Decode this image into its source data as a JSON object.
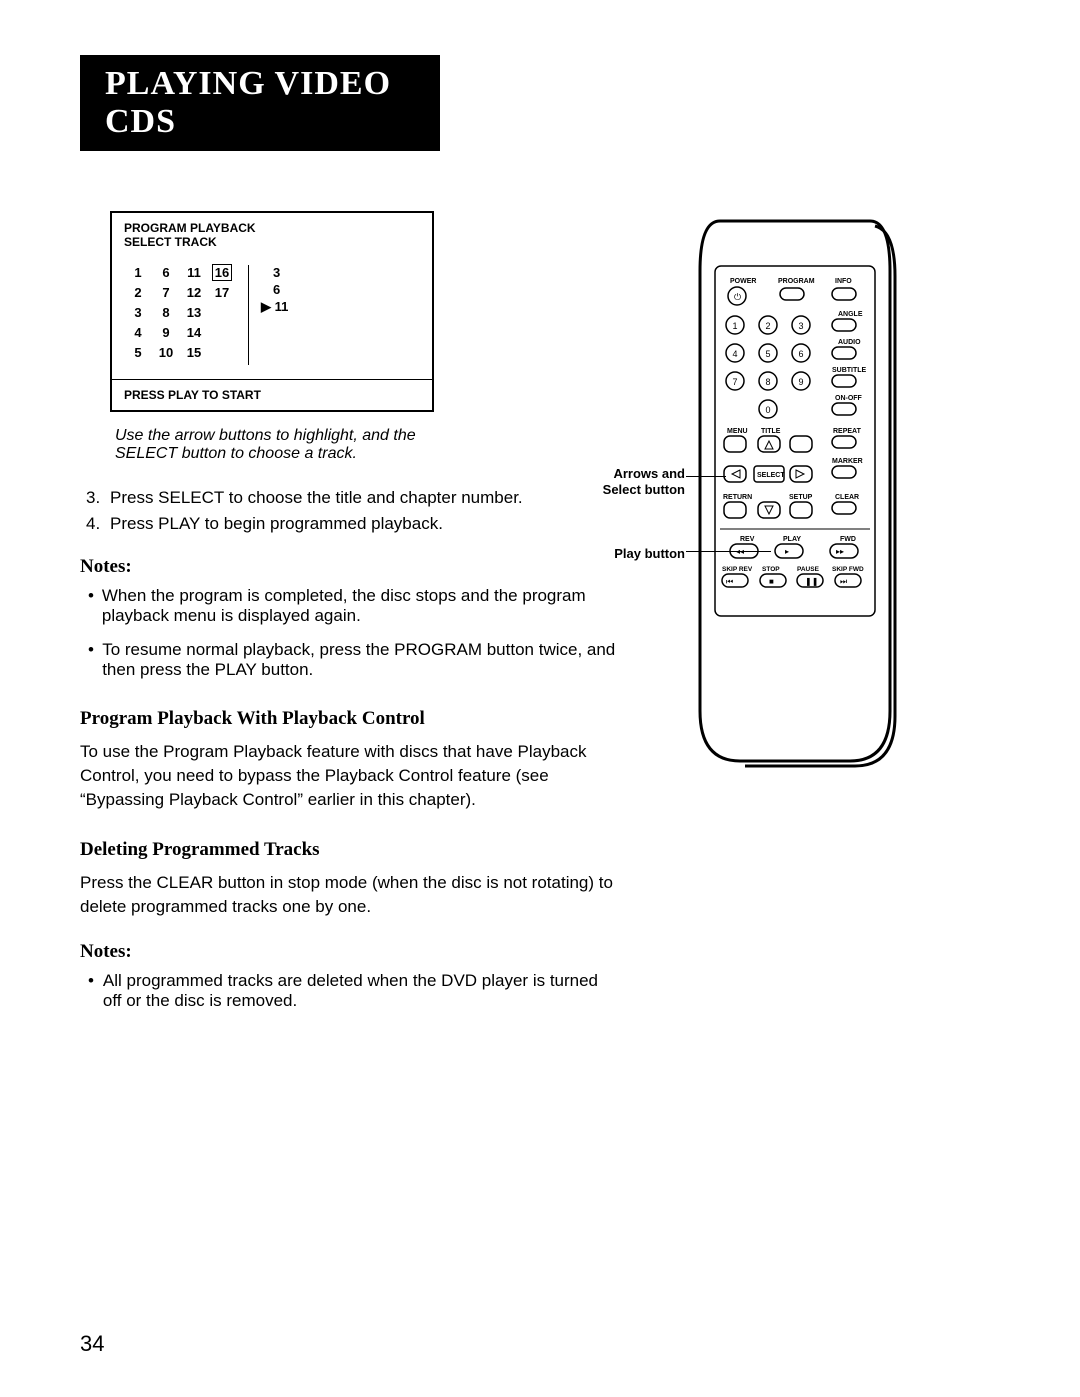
{
  "title": "PLAYING VIDEO CDS",
  "osd": {
    "header1": "PROGRAM PLAYBACK",
    "header2": "SELECT TRACK",
    "footer": "PRESS PLAY TO START",
    "tracks": [
      "1",
      "2",
      "3",
      "4",
      "5",
      "6",
      "7",
      "8",
      "9",
      "10",
      "11",
      "12",
      "13",
      "14",
      "15",
      "16",
      "17"
    ],
    "highlighted": "16",
    "selected": [
      "3",
      "6",
      "11"
    ]
  },
  "caption": "Use the arrow buttons to highlight, and the SELECT  button to choose a track.",
  "steps": {
    "s3n": "3.",
    "s3": "Press SELECT to choose the title and chapter number.",
    "s4n": "4.",
    "s4": "Press PLAY to begin programmed playback."
  },
  "notes1_h": "Notes:",
  "notes1": [
    "When the program is completed, the disc stops and the program playback menu is displayed again.",
    "To resume normal playback, press the PROGRAM button twice, and then press the PLAY button."
  ],
  "sec_ppc_h": "Program Playback With Playback Control",
  "sec_ppc": "To use the Program Playback feature with discs that have Playback Control, you need to bypass the Playback Control feature (see “Bypassing Playback Control” earlier in this chapter).",
  "sec_del_h": "Deleting Programmed Tracks",
  "sec_del": "Press the CLEAR button in stop mode (when the disc is not rotating) to delete programmed tracks one by one.",
  "notes2_h": "Notes:",
  "notes2": [
    "All programmed tracks are deleted when the DVD player is turned off or the disc is removed."
  ],
  "page_number": "34",
  "callouts": {
    "arrows": "Arrows and Select button",
    "play": "Play button"
  },
  "remote": {
    "power": "POWER",
    "program": "PROGRAM",
    "info": "INFO",
    "angle": "ANGLE",
    "audio": "AUDIO",
    "subtitle": "SUBTITLE",
    "onoff": "ON-OFF",
    "menu": "MENU",
    "title": "TITLE",
    "repeat": "REPEAT",
    "select": "SELECT",
    "marker": "MARKER",
    "return": "RETURN",
    "setup": "SETUP",
    "clear": "CLEAR",
    "rev": "REV",
    "play": "PLAY",
    "fwd": "FWD",
    "skiprev": "SKIP REV",
    "stop": "STOP",
    "pause": "PAUSE",
    "skipfwd": "SKIP FWD",
    "nums": [
      "1",
      "2",
      "3",
      "4",
      "5",
      "6",
      "7",
      "8",
      "9",
      "0"
    ]
  }
}
